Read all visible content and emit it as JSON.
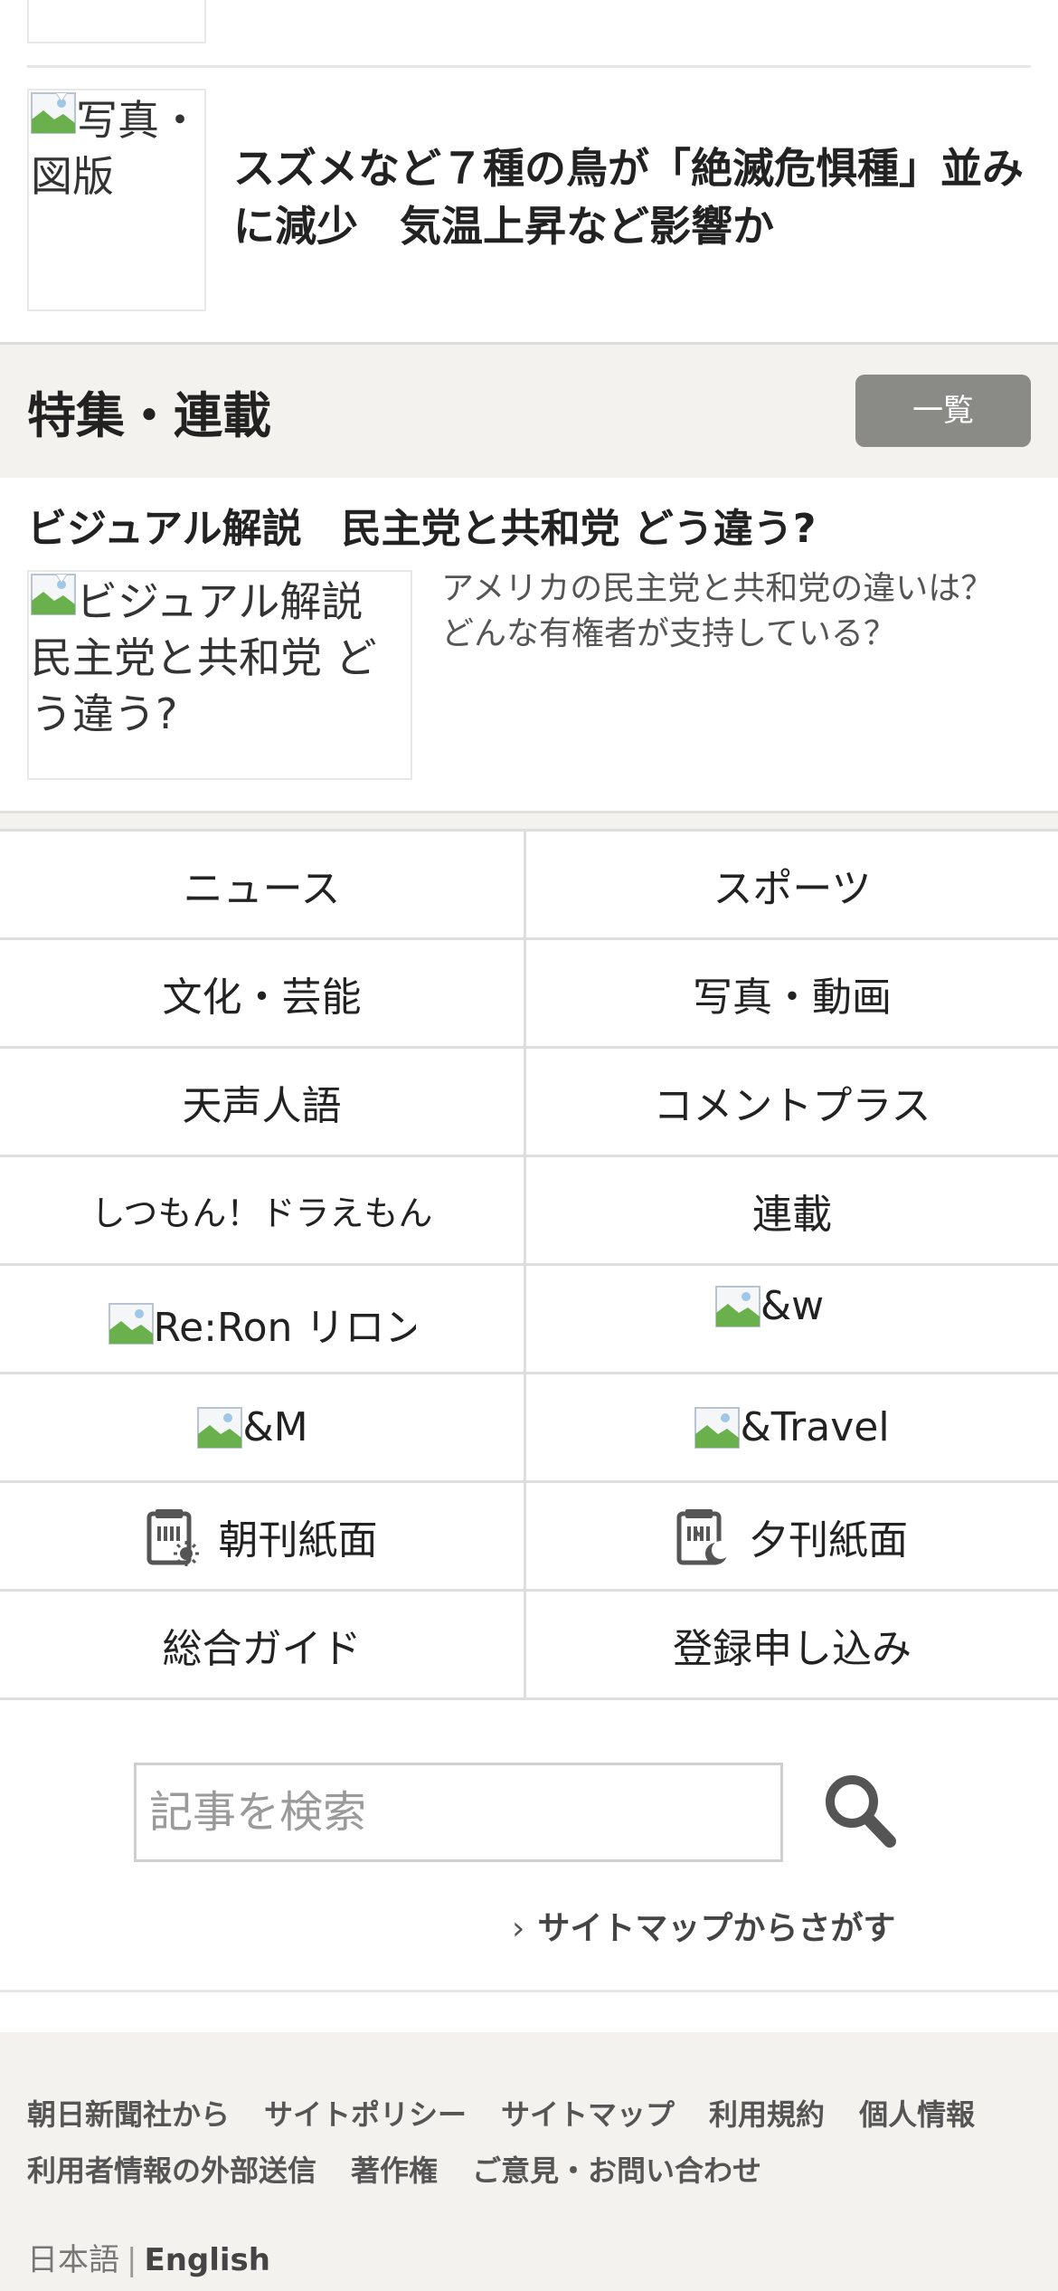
{
  "top_article": {
    "thumb_alt": "写真・図版",
    "title": "スズメなど７種の鳥が「絶滅危惧種」並みに減少　気温上昇など影響か"
  },
  "features": {
    "section_title": "特集・連載",
    "list_button": "一覧",
    "item": {
      "title": "ビジュアル解説　民主党と共和党 どう違う?",
      "thumb_alt": "ビジュアル解説　民主党と共和党 どう違う?",
      "description": "アメリカの民主党と共和党の違いは？どんな有権者が支持している？"
    }
  },
  "nav": {
    "news": "ニュース",
    "sports": "スポーツ",
    "culture": "文化・芸能",
    "photo_video": "写真・動画",
    "tenseijingo": "天声人語",
    "comment_plus": "コメントプラス",
    "shitsumon": "しつもん！ドラえもん",
    "rensai": "連載",
    "reron": "Re:Ron リロン",
    "and_w": "&w",
    "and_m": "&M",
    "and_travel": "&Travel",
    "morning_paper": "朝刊紙面",
    "evening_paper": "夕刊紙面",
    "guide": "総合ガイド",
    "register": "登録申し込み"
  },
  "search": {
    "placeholder": "記事を検索",
    "sitemap_link": "サイトマップからさがす"
  },
  "footer": {
    "links": [
      "朝日新聞社から",
      "サイトポリシー",
      "サイトマップ",
      "利用規約",
      "個人情報",
      "利用者情報の外部送信",
      "著作権",
      "ご意見・お問い合わせ"
    ],
    "lang_ja": "日本語",
    "lang_sep": "|",
    "lang_en": "English"
  },
  "icons": {
    "broken_image": "broken-image-icon",
    "search": "search-icon",
    "morning_paper": "morning-paper-icon",
    "evening_paper": "evening-paper-icon",
    "chevron": "chevron-right-icon"
  },
  "colors": {
    "section_bg": "#f3f2ee",
    "button_bg": "#8a8a86",
    "divider": "#dedede",
    "text": "#222222"
  }
}
